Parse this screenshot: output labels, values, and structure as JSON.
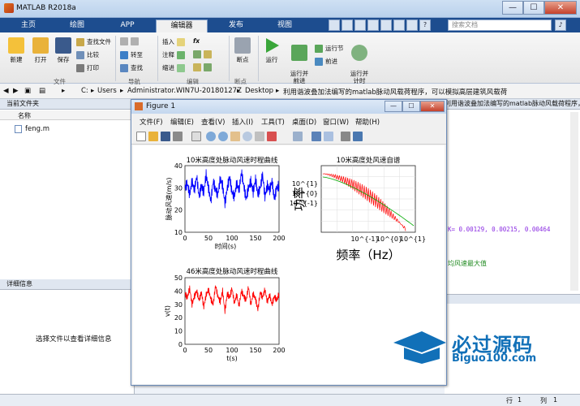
{
  "window": {
    "title": "MATLAB R2018a",
    "buttons": [
      "—",
      "☐",
      "✕"
    ]
  },
  "tabs": [
    {
      "label": "主页"
    },
    {
      "label": "绘图"
    },
    {
      "label": "APP"
    },
    {
      "label": "编辑器"
    },
    {
      "label": "发布"
    },
    {
      "label": "视图"
    }
  ],
  "quick_access": {
    "help": "?",
    "search_placeholder": "搜索文档",
    "bell": "♪"
  },
  "ribbon": {
    "file": {
      "label": "文件",
      "new": "新建",
      "open": "打开",
      "save": "保存",
      "find_files": "查找文件",
      "compare": "比较",
      "print": "打印"
    },
    "nav": {
      "label": "导航",
      "goto": "转至",
      "find": "查找"
    },
    "edit": {
      "label": "编辑",
      "insert": "插入",
      "comment": "注释",
      "indent": "缩进",
      "fx": "fx"
    },
    "breakpoint": {
      "label": "断点",
      "breakpoints": "断点"
    },
    "run": {
      "run": "运行",
      "run_advance": "运行并\n前进",
      "run_section": "运行节",
      "advance": "前进",
      "run_time": "运行并\n计时"
    }
  },
  "address": {
    "segments": [
      "C:",
      "Users",
      "Administrator.WIN7U-20180127Z",
      "Desktop",
      "利用谐波叠加法编写的matlab脉动风载荷程序，可以模拟高层建筑风载荷"
    ]
  },
  "left_panel": {
    "header": "当前文件夹",
    "column": "名称",
    "files": [
      {
        "name": "feng.m"
      }
    ],
    "details_header": "详细信息",
    "details_msg": "选择文件以查看详细信息"
  },
  "right_panel": {
    "crumb": "利用谐波叠加法编写的matlab脉动风载荷程序，可以模拟高层建筑风载荷",
    "code_line": "K= 0.00129, 0.00215, 0.00464",
    "comment": "均风速最大值"
  },
  "status": {
    "row_label": "行",
    "row_value": "1",
    "col_label": "列",
    "col_value": "1"
  },
  "figure": {
    "title": "Figure 1",
    "menu": [
      "文件(F)",
      "编辑(E)",
      "查看(V)",
      "插入(I)",
      "工具(T)",
      "桌面(D)",
      "窗口(W)",
      "帮助(H)"
    ]
  },
  "chart_data": [
    {
      "type": "line",
      "title": "10米高度处脉动风速时程曲线",
      "xlabel": "时间(s)",
      "ylabel": "脉动风速(m/s)",
      "xlim": [
        0,
        200
      ],
      "ylim": [
        10,
        40
      ],
      "xticks": [
        0,
        50,
        100,
        150,
        200
      ],
      "yticks": [
        10,
        20,
        30,
        40
      ],
      "series": [
        {
          "color": "#0000ff",
          "x": [
            0,
            5,
            10,
            15,
            20,
            25,
            30,
            35,
            40,
            45,
            50,
            55,
            60,
            65,
            70,
            75,
            80,
            85,
            90,
            95,
            100,
            105,
            110,
            115,
            120,
            125,
            130,
            135,
            140,
            145,
            150,
            155,
            160,
            165,
            170,
            175,
            180,
            185,
            190,
            195,
            200
          ],
          "values": [
            30,
            32,
            27,
            33,
            29,
            35,
            26,
            31,
            28,
            36,
            30,
            24,
            33,
            29,
            27,
            34,
            31,
            23,
            30,
            35,
            28,
            26,
            32,
            29,
            37,
            31,
            25,
            30,
            33,
            28,
            34,
            27,
            30,
            36,
            26,
            31,
            29,
            33,
            25,
            30,
            31
          ]
        }
      ]
    },
    {
      "type": "line",
      "title": "10米高度处风速自谱",
      "xlabel": "频率（Hz）",
      "ylabel": "功率",
      "xscale": "log",
      "yscale": "log",
      "xticks": [
        "10^{-1}",
        "10^{0}",
        "10^{1}"
      ],
      "yticks": [
        "10^{1}",
        "10^{0}",
        "10^{-1}"
      ],
      "series": [
        {
          "color": "#ff0000"
        },
        {
          "color": "#00aa00"
        }
      ]
    },
    {
      "type": "line",
      "title": "46米高度处脉动风速时程曲线",
      "xlabel": "t(s)",
      "ylabel": "v(t)",
      "xlim": [
        0,
        200
      ],
      "ylim": [
        0,
        50
      ],
      "xticks": [
        0,
        50,
        100,
        150,
        200
      ],
      "yticks": [
        0,
        10,
        20,
        30,
        40,
        50
      ],
      "series": [
        {
          "color": "#ff0000",
          "x": [
            0,
            5,
            10,
            15,
            20,
            25,
            30,
            35,
            40,
            45,
            50,
            55,
            60,
            65,
            70,
            75,
            80,
            85,
            90,
            95,
            100,
            105,
            110,
            115,
            120,
            125,
            130,
            135,
            140,
            145,
            150,
            155,
            160,
            165,
            170,
            175,
            180,
            185,
            190,
            195,
            200
          ],
          "values": [
            38,
            35,
            42,
            30,
            36,
            40,
            33,
            39,
            28,
            37,
            41,
            34,
            30,
            44,
            36,
            32,
            40,
            25,
            38,
            35,
            42,
            31,
            37,
            29,
            40,
            36,
            33,
            43,
            30,
            38,
            34,
            26,
            39,
            35,
            41,
            32,
            37,
            30,
            36,
            33,
            38
          ]
        }
      ]
    }
  ],
  "watermark": {
    "brand": "必过源码",
    "url": "Biguo100.com"
  }
}
